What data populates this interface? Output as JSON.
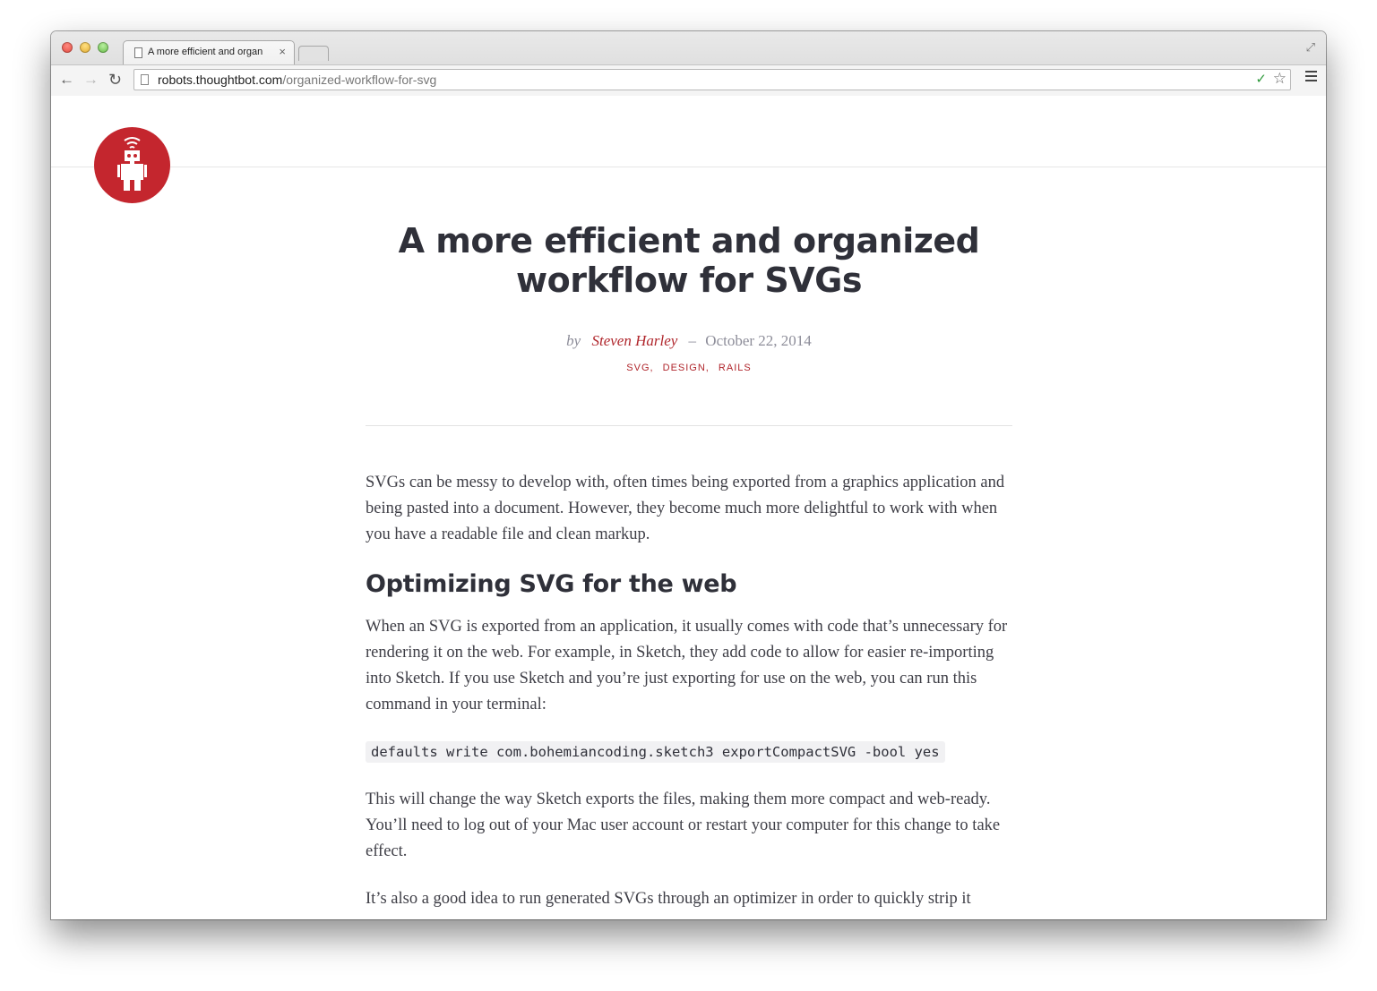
{
  "browser": {
    "tab_title": "A more efficient and organ",
    "tab_close": "×",
    "url_host": "robots.thoughtbot.com",
    "url_path": "/organized-workflow-for-svg",
    "nav_back": "←",
    "nav_forward": "→",
    "nav_reload": "↻",
    "star": "☆",
    "fullscreen": "⤢",
    "extension": "✓"
  },
  "site": {
    "logo_icon": "robot-icon",
    "brand_color": "#c4262e"
  },
  "article": {
    "title_line1": "A more efficient and organized",
    "title_line2": "workflow for SVGs",
    "by": "by",
    "author": "Steven Harley",
    "dash": "–",
    "date": "October 22, 2014",
    "tags": [
      "SVG,",
      "DESIGN,",
      "RAILS"
    ],
    "p1": "SVGs can be messy to develop with, often times being exported from a graphics application and being pasted into a document. However, they become much more delightful to work with when you have a readable file and clean markup.",
    "h2": "Optimizing SVG for the web",
    "p2": "When an SVG is exported from an application, it usually comes with code that’s unnecessary for rendering it on the web. For example, in Sketch, they add code to allow for easier re-importing into Sketch. If you use Sketch and you’re just exporting for use on the web, you can run this command in your terminal:",
    "code": "defaults write com.bohemiancoding.sketch3 exportCompactSVG -bool yes",
    "p3": "This will change the way Sketch exports the files, making them more compact and web-ready. You’ll need to log out of your Mac user account or restart your computer for this change to take effect.",
    "p4": "It’s also a good idea to run generated SVGs through an optimizer in order to quickly strip it"
  }
}
